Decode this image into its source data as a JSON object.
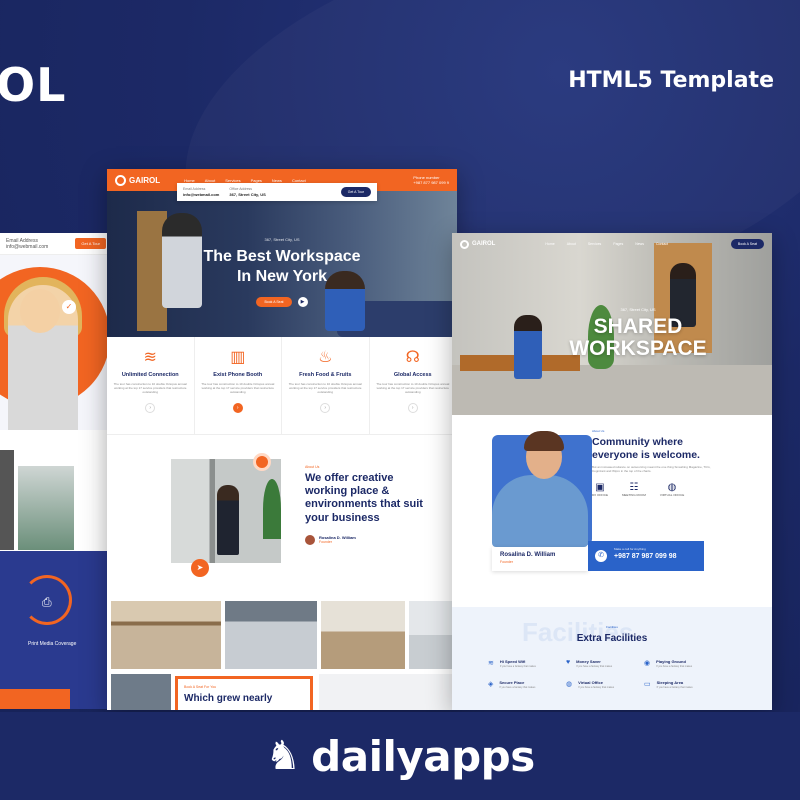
{
  "promo": {
    "brand_fragment": "OL",
    "tagline": "HTML5 Template"
  },
  "left_screen": {
    "email_label": "Email Address",
    "email": "info@webmail.com",
    "button": "Get A Tour",
    "print_label": "Print Media Coverage"
  },
  "center_screen": {
    "logo": "GAIROL",
    "menu": [
      "Home",
      "About",
      "Services",
      "Pages",
      "News",
      "Contact"
    ],
    "phone_label": "Phone number",
    "phone": "+987 877 987 099 9",
    "info": {
      "email_label": "Email Address",
      "email": "info@webmail.com",
      "address_label": "Office Address",
      "address": "367, Street City, US",
      "button": "Get A Tour"
    },
    "hero": {
      "subtitle": "367, Street City, US",
      "title_line1": "The Best Workspace",
      "title_line2": "In New York",
      "button": "Book A Seat"
    },
    "features": [
      {
        "icon": "wifi-icon",
        "glyph": "≋",
        "title": "Unlimited Connection",
        "desc": "The tour has construction to 10 double Octopus annual working at the top 17 service providers that restructure outstanding"
      },
      {
        "icon": "phone-booth-icon",
        "glyph": "▥",
        "title": "Exist Phone Booth",
        "desc": "The tour has construction to 10 double Octopus annual working at the top 17 service providers that restructure outstanding"
      },
      {
        "icon": "food-icon",
        "glyph": "♨",
        "title": "Fresh Food & Fruits",
        "desc": "The tour has construction to 10 double Octopus annual working at the top 17 service providers that restructure outstanding"
      },
      {
        "icon": "global-access-icon",
        "glyph": "☊",
        "title": "Global Access",
        "desc": "The tour has construction to 10 double Octopus annual working at the top 17 service providers that restructure outstanding"
      }
    ],
    "about": {
      "label": "About Us",
      "title": "We offer creative working place & environments that suit your business",
      "author": "Rosalina D. William",
      "role": "Founder"
    },
    "bottom_card": {
      "label": "Book A Seat For You",
      "title": "Which grew nearly"
    }
  },
  "right_screen": {
    "logo": "GAIROL",
    "menu": [
      "Home",
      "About",
      "Services",
      "Pages",
      "News",
      "Contact"
    ],
    "button": "Book A Seat",
    "hero": {
      "subtitle": "367, Street City, US",
      "title_line1": "SHARED",
      "title_line2": "WORKSPACE"
    },
    "about": {
      "label": "About Us",
      "title": "Community where everyone is welcome.",
      "desc": "But an increased reliance on outsourcing meant the one thing Smashing Magazine, TCG, Cognizant and Wipro in the top of the charts.",
      "icons": [
        {
          "icon": "briefcase-icon",
          "glyph": "▣",
          "label": "DX OFFICE"
        },
        {
          "icon": "meeting-room-icon",
          "glyph": "☷",
          "label": "MEETING ROOM"
        },
        {
          "icon": "virtual-office-icon",
          "glyph": "◍",
          "label": "VIRTUAL OFFICE"
        }
      ],
      "name": "Rosalina D. William",
      "role": "Founder",
      "phone_label": "Make a call for Anything",
      "phone": "+987 87 987 099 98"
    },
    "facilities": {
      "bg_word": "Facilities",
      "label": "Facilities",
      "title": "Extra Facilities",
      "items": [
        {
          "icon": "wifi-icon",
          "glyph": "≋",
          "title": "Hi Speed Wifi",
          "desc": "If you have a fantasy that makes"
        },
        {
          "icon": "money-saver-icon",
          "glyph": "♥",
          "title": "Money Saver",
          "desc": "If you have a fantasy that makes"
        },
        {
          "icon": "playing-ground-icon",
          "glyph": "◉",
          "title": "Playing Ground",
          "desc": "If you have a fantasy that makes"
        },
        {
          "icon": "secure-place-icon",
          "glyph": "◈",
          "title": "Secure Place",
          "desc": "If you have a fantasy that makes"
        },
        {
          "icon": "virtual-office-icon",
          "glyph": "◍",
          "title": "Virtual Office",
          "desc": "If you have a fantasy that makes"
        },
        {
          "icon": "sleeping-area-icon",
          "glyph": "▭",
          "title": "Sleeping Area",
          "desc": "If you have a fantasy that makes"
        }
      ]
    }
  },
  "footer": {
    "logo_text": "dailyapps"
  },
  "colors": {
    "navy": "#1c2966",
    "orange": "#f26522",
    "blue": "#2a63c9"
  }
}
